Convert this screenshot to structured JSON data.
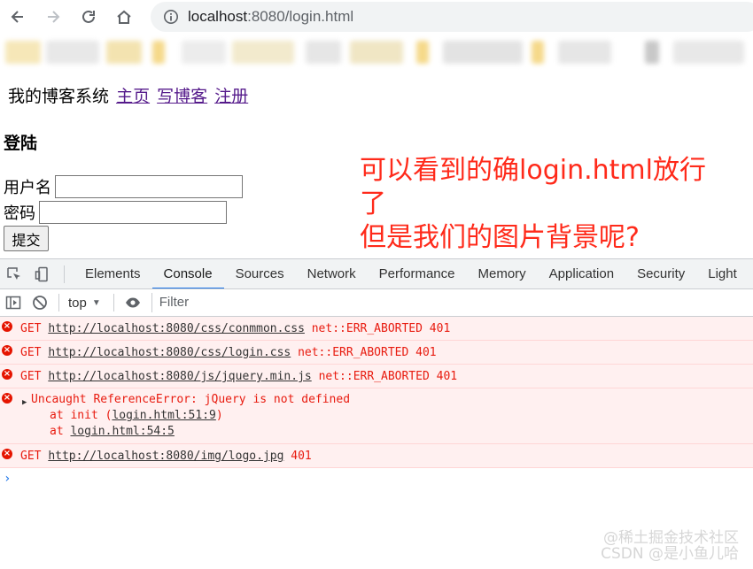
{
  "browser": {
    "url_host": "localhost",
    "url_rest": ":8080/login.html"
  },
  "site": {
    "brand": "我的博客系统",
    "links": [
      "主页",
      "写博客",
      "注册"
    ]
  },
  "login": {
    "title": "登陆",
    "username_label": "用户名",
    "password_label": "密码",
    "submit_label": "提交"
  },
  "annotation": {
    "line1": "可以看到的确login.html放行",
    "line2": "了",
    "line3": "但是我们的图片背景呢?"
  },
  "devtools": {
    "tabs": [
      "Elements",
      "Console",
      "Sources",
      "Network",
      "Performance",
      "Memory",
      "Application",
      "Security",
      "Light"
    ],
    "active_tab": "Console",
    "context": "top",
    "filter_placeholder": "Filter"
  },
  "console": {
    "errors": [
      {
        "method": "GET",
        "url": "http://localhost:8080/css/conmmon.css",
        "status": "net::ERR_ABORTED 401"
      },
      {
        "method": "GET",
        "url": "http://localhost:8080/css/login.css",
        "status": "net::ERR_ABORTED 401"
      },
      {
        "method": "GET",
        "url": "http://localhost:8080/js/jquery.min.js",
        "status": "net::ERR_ABORTED 401"
      }
    ],
    "exception": {
      "message": "Uncaught ReferenceError: jQuery is not defined",
      "frame1_prefix": "at init (",
      "frame1_link": "login.html:51:9",
      "frame1_suffix": ")",
      "frame2_prefix": "at ",
      "frame2_link": "login.html:54:5"
    },
    "last_error": {
      "method": "GET",
      "url": "http://localhost:8080/img/logo.jpg",
      "status": "401"
    }
  },
  "watermark": {
    "line1": "@稀土掘金技术社区",
    "line2": "CSDN @是小鱼儿哈"
  },
  "colors": {
    "annotation": "#ff2a1a",
    "error_text": "#e81b0f",
    "error_bg": "#fff0f0",
    "link_visited": "#551a8b",
    "active_tab_underline": "#1a73e8"
  }
}
